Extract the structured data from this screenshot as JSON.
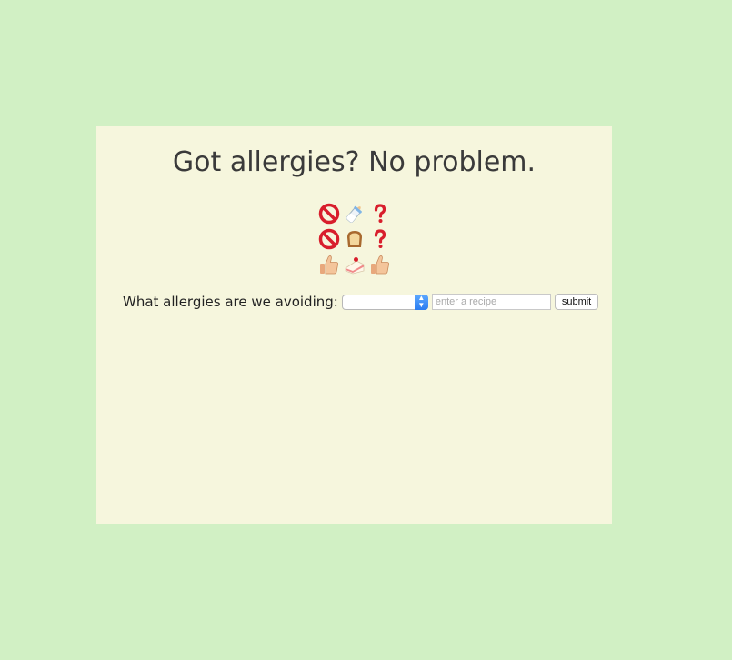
{
  "page": {
    "title": "Got allergies? No problem."
  },
  "emoji_grid": {
    "rows": [
      [
        "prohibited-icon",
        "baby-bottle-icon",
        "question-mark-icon"
      ],
      [
        "prohibited-icon",
        "bread-icon",
        "question-mark-icon"
      ],
      [
        "thumbs-up-icon",
        "cake-icon",
        "thumbs-up-icon"
      ]
    ]
  },
  "form": {
    "label": "What allergies are we avoiding:",
    "allergy_select_value": "",
    "recipe_placeholder": "enter a recipe",
    "submit_label": "submit"
  },
  "colors": {
    "page_background": "#d1f0c4",
    "card_background": "#f6f6dd",
    "select_arrow": "#2a7cf0"
  }
}
